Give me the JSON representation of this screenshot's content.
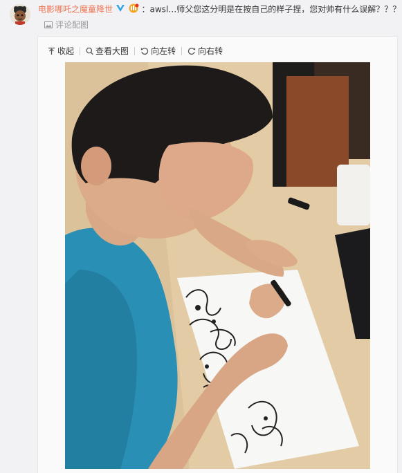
{
  "comment": {
    "username": "电影哪吒之魔童降世",
    "text": "：awsl…师父您这分明是在按自己的样子捏，您对帅有什么误解？？？",
    "sub_link": "评论配图"
  },
  "toolbar": {
    "collapse_label": "收起",
    "view_large_label": "查看大图",
    "rotate_left_label": "向左转",
    "rotate_right_label": "向右转"
  },
  "photo": {
    "icon": "photo-icon"
  },
  "colors": {
    "username": "#eb7350",
    "verified": "#2aa5e8",
    "muted": "#999999",
    "page_bg": "#f2f2f5"
  }
}
